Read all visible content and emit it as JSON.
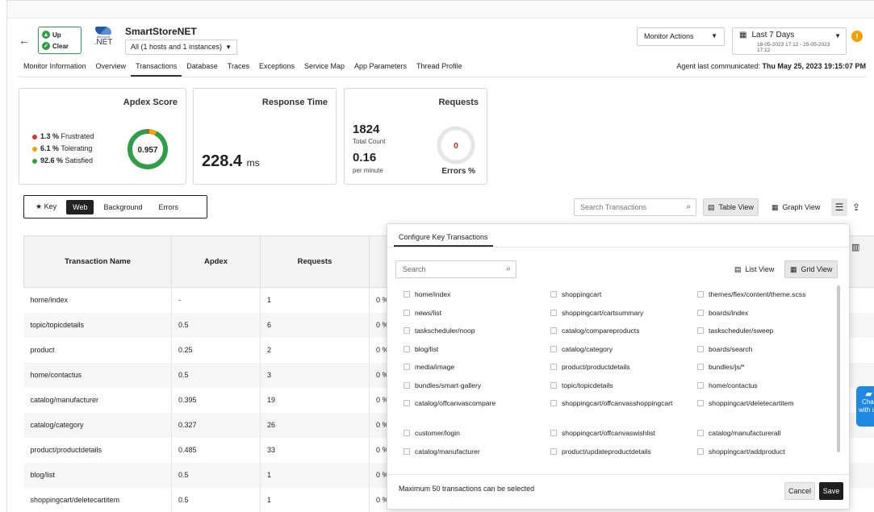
{
  "header": {
    "status_up": "Up",
    "status_clear": "Clear",
    "logo_small": "Microsoft",
    "logo_text": ".NET",
    "app_name": "SmartStoreNET",
    "host_selector": "All (1 hosts and 1 instances)",
    "monitor_actions": "Monitor Actions",
    "date_range": "Last 7 Days",
    "date_sub": "18-05-2023 17:12 - 25-05-2023 17:12",
    "warning": "!"
  },
  "tabs": [
    "Monitor Information",
    "Overview",
    "Transactions",
    "Database",
    "Traces",
    "Exceptions",
    "Service Map",
    "App Parameters",
    "Thread Profile"
  ],
  "active_tab": "Transactions",
  "agent": {
    "label": "Agent last communicated:",
    "time": "Thu May 25, 2023 19:15:07 PM"
  },
  "apdex": {
    "title": "Apdex Score",
    "score": "0.957",
    "frustrated_pct": "1.3 %",
    "frustrated_label": "Frustrated",
    "tolerating_pct": "6.1 %",
    "tolerating_label": "Tolerating",
    "satisfied_pct": "92.6 %",
    "satisfied_label": "Satisfied",
    "fractions": {
      "frustrated": 0.013,
      "tolerating": 0.061,
      "satisfied": 0.926
    }
  },
  "response_time": {
    "title": "Response Time",
    "value": "228.4",
    "unit": "ms"
  },
  "requests": {
    "title": "Requests",
    "total": "1824",
    "total_label": "Total Count",
    "per_minute": "0.16",
    "per_minute_label": "per minute",
    "errors_value": "0",
    "errors_label": "Errors %"
  },
  "filters": {
    "key": "Key",
    "web": "Web",
    "background": "Background",
    "errors": "Errors"
  },
  "search_tx_placeholder": "Search Transactions",
  "views": {
    "table": "Table View",
    "graph": "Graph View"
  },
  "table": {
    "headers": [
      "Transaction Name",
      "Apdex",
      "Requests"
    ],
    "rows": [
      [
        "home/index",
        "-",
        "1",
        "0 %"
      ],
      [
        "topic/topicdetails",
        "0.5",
        "6",
        "0 %"
      ],
      [
        "product",
        "0.25",
        "2",
        "0 %"
      ],
      [
        "home/contactus",
        "0.5",
        "3",
        "0 %"
      ],
      [
        "catalog/manufacturer",
        "0.395",
        "19",
        "0 %"
      ],
      [
        "catalog/category",
        "0.327",
        "26",
        "0 %"
      ],
      [
        "product/productdetails",
        "0.485",
        "33",
        "0 %"
      ],
      [
        "blog/list",
        "0.5",
        "1",
        "0 %"
      ],
      [
        "shoppingcart/deletecartitem",
        "0.5",
        "1",
        "0 %"
      ]
    ]
  },
  "panel": {
    "tab": "Configure Key Transactions",
    "search_placeholder": "Search",
    "list_view": "List View",
    "grid_view": "Grid View",
    "items": [
      "home/index",
      "shoppingcart",
      "themes/flex/content/theme.scss",
      "news/list",
      "shoppingcart/cartsummary",
      "boards/index",
      "taskscheduler/noop",
      "catalog/compareproducts",
      "taskscheduler/sweep",
      "blog/list",
      "catalog/category",
      "boards/search",
      "media/image",
      "product/productdetails",
      "bundles/js/*",
      "bundles/smart-gallery",
      "topic/topicdetails",
      "home/contactus",
      "catalog/offcanvascompare",
      "shoppingcart/offcanvasshoppingcart",
      "shoppingcart/deletecartitem",
      "customer/login",
      "shoppingcart/offcanvaswishlist",
      "catalog/manufacturerall",
      "catalog/manufacturer",
      "product/updateproductdetails",
      "shoppingcart/addproduct"
    ],
    "footer_msg": "Maximum 50 transactions can be selected",
    "cancel": "Cancel",
    "save": "Save"
  },
  "chat": "Chat with us",
  "colors": {
    "up_green": "#2e9e49",
    "frustrated": "#e03131",
    "tolerating": "#f0a200",
    "satisfied": "#2e9e49",
    "error_red": "#c62828",
    "chat_blue": "#1e88e5"
  }
}
